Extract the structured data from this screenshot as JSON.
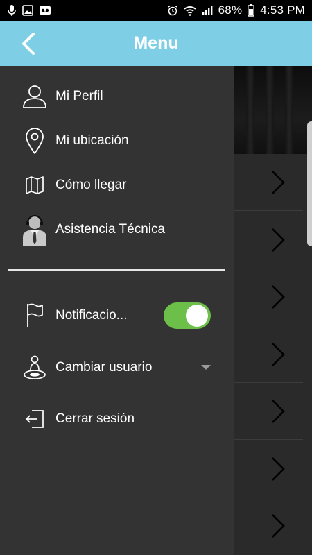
{
  "status_bar": {
    "battery_percent": "68%",
    "time": "4:53 PM",
    "left_icons": [
      "mic-icon",
      "image-icon",
      "voicemail-icon"
    ],
    "right_icons": [
      "alarm-icon",
      "wifi-icon",
      "signal-icon",
      "battery-icon"
    ]
  },
  "header": {
    "title": "Menu",
    "back_icon": "chevron-left-icon",
    "background_color": "#7ecfe6"
  },
  "drawer": {
    "items": [
      {
        "label": "Mi Perfil",
        "icon": "user-icon"
      },
      {
        "label": "Mi ubicación",
        "icon": "location-pin-icon"
      },
      {
        "label": "Cómo llegar",
        "icon": "map-icon"
      },
      {
        "label": "Asistencia Técnica",
        "icon": "support-agent-icon"
      }
    ],
    "settings": [
      {
        "label": "Notificacio...",
        "icon": "flag-icon",
        "toggle_on": true
      },
      {
        "label": "Cambiar usuario",
        "icon": "change-user-icon"
      },
      {
        "label": "Cerrar sesión",
        "icon": "logout-icon"
      }
    ],
    "toggle_color": "#6cc04a"
  },
  "background_list": {
    "row_count": 7,
    "row_icon": "chevron-right-icon"
  }
}
